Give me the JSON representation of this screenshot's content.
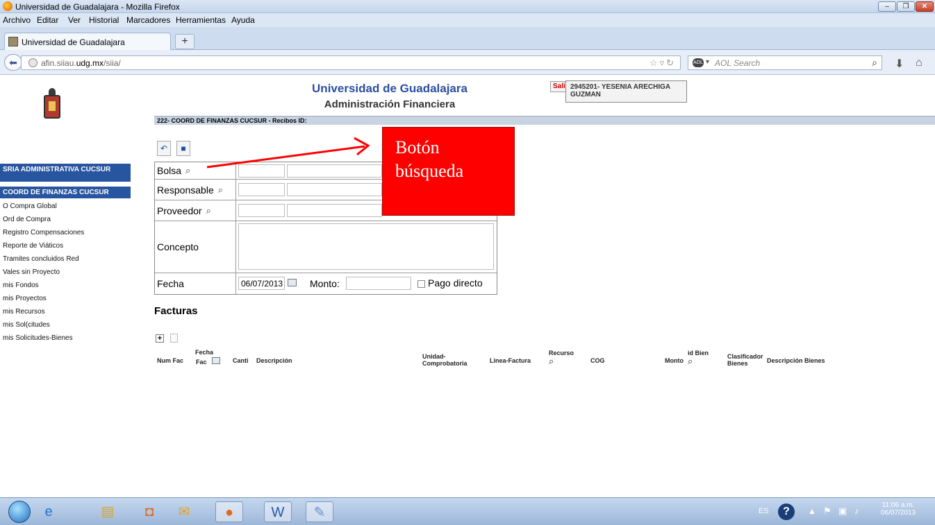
{
  "window": {
    "title": "Universidad de Guadalajara - Mozilla Firefox"
  },
  "menu": [
    "Archivo",
    "Editar",
    "Ver",
    "Historial",
    "Marcadores",
    "Herramientas",
    "Ayuda"
  ],
  "tab": {
    "label": "Universidad de Guadalajara",
    "new_tab": "+"
  },
  "urlbar": {
    "url_prefix": "afin.siiau.",
    "url_domain": "udg.mx",
    "url_path": "/siia/"
  },
  "search": {
    "placeholder": "AOL Search",
    "engine": "AOL"
  },
  "header": {
    "title": "Universidad de Guadalajara",
    "subtitle": "Administración Financiera",
    "logout": "Salir",
    "user": "2945201- YESENIA ARECHIGA GUZMAN",
    "dept_bar": "222- COORD DE FINANZAS CUCSUR - Recibos  ID:"
  },
  "sidebar": {
    "heading1": "SRIA ADMINISTRATIVA CUCSUR",
    "heading2": "COORD DE FINANZAS CUCSUR",
    "items": [
      "O Compra Global",
      "Ord de Compra",
      "Registro Compensaciones",
      "Reporte de Viáticos",
      "Tramites concluidos Red",
      "Vales sin Proyecto",
      "mis Fondos",
      "mis Proyectos",
      "mis Recursos",
      "mis Sol(citudes",
      "mis Solicitudes-Bienes"
    ]
  },
  "form": {
    "bolsa": "Bolsa",
    "responsable": "Responsable",
    "proveedor": "Proveedor",
    "concepto": "Concepto",
    "fecha": "Fecha",
    "fecha_value": "06/07/2013",
    "monto": "Monto:",
    "pago_directo": "Pago directo"
  },
  "facturas": {
    "title": "Facturas",
    "columns": {
      "num_fac": "Num Fac",
      "fecha_fac_1": "Fecha",
      "fecha_fac_2": "Fac",
      "canti": "Canti",
      "descripcion": "Descripción",
      "unidad_1": "Unidad-",
      "unidad_2": "Comprobatoria",
      "linea": "Linea-Factura",
      "recurso": "Recurso",
      "cog": "COG",
      "monto": "Monto",
      "id_bien": "id Bien",
      "clasificador_1": "Clasificador",
      "clasificador_2": "Bienes",
      "desc_bienes": "Descripción Bienes"
    }
  },
  "annotation": {
    "line1": "Botón",
    "line2": "búsqueda"
  },
  "taskbar": {
    "lang": "ES",
    "time": "11:06 a.m.",
    "date": "06/07/2013"
  }
}
